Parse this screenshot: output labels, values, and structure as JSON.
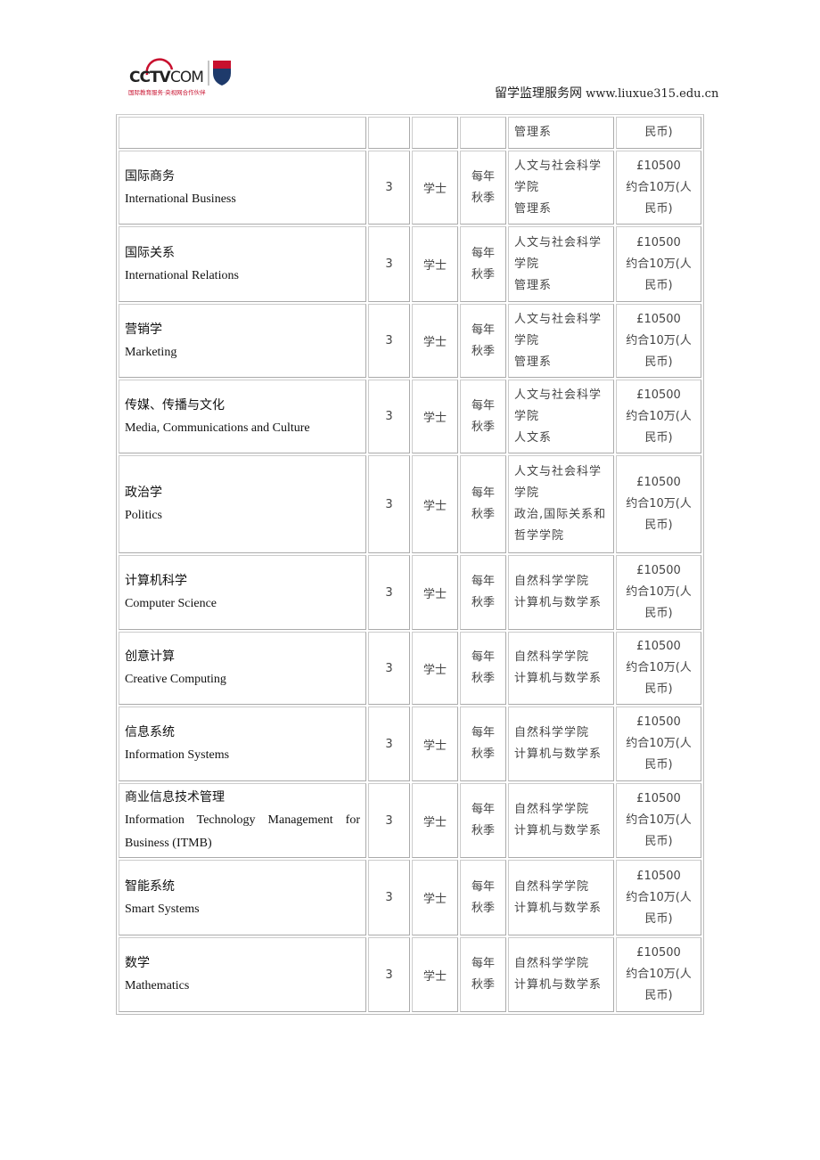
{
  "header": {
    "logo_text": "CCTV.com",
    "logo_tagline": "国际教育服务·央视网合作伙伴",
    "site_name": "留学监理服务网",
    "site_url": "www.liuxue315.edu.cn"
  },
  "rows": [
    {
      "zh": "",
      "en": "",
      "years": "",
      "degree": "",
      "intake": "",
      "faculty": [
        "管理系"
      ],
      "fee": [
        "民币)"
      ]
    },
    {
      "zh": "国际商务",
      "en": "International Business",
      "years": "3",
      "degree": "学士",
      "intake": [
        "每年",
        "秋季"
      ],
      "faculty": [
        "人文与社会科学",
        "学院",
        "管理系"
      ],
      "fee": [
        "£10500",
        "约合10万(人",
        "民币)"
      ]
    },
    {
      "zh": "国际关系",
      "en": "International Relations",
      "years": "3",
      "degree": "学士",
      "intake": [
        "每年",
        "秋季"
      ],
      "faculty": [
        "人文与社会科学",
        "学院",
        "管理系"
      ],
      "fee": [
        "£10500",
        "约合10万(人",
        "民币)"
      ]
    },
    {
      "zh": "营销学",
      "en": "Marketing",
      "years": "3",
      "degree": "学士",
      "intake": [
        "每年",
        "秋季"
      ],
      "faculty": [
        "人文与社会科学",
        "学院",
        "管理系"
      ],
      "fee": [
        "£10500",
        "约合10万(人",
        "民币)"
      ]
    },
    {
      "zh": "传媒、传播与文化",
      "en": "Media, Communications and Culture",
      "years": "3",
      "degree": "学士",
      "intake": [
        "每年",
        "秋季"
      ],
      "faculty": [
        "人文与社会科学",
        "学院",
        "人文系"
      ],
      "fee": [
        "£10500",
        "约合10万(人",
        "民币)"
      ]
    },
    {
      "zh": "政治学",
      "en": "Politics",
      "years": "3",
      "degree": "学士",
      "intake": [
        "每年",
        "秋季"
      ],
      "faculty": [
        "人文与社会科学",
        "学院",
        "政治,国际关系和",
        "哲学学院"
      ],
      "fee": [
        "£10500",
        "约合10万(人",
        "民币)"
      ]
    },
    {
      "zh": "计算机科学",
      "en": "Computer Science",
      "years": "3",
      "degree": "学士",
      "intake": [
        "每年",
        "秋季"
      ],
      "faculty": [
        "自然科学学院",
        "计算机与数学系"
      ],
      "fee": [
        "£10500",
        "约合10万(人",
        "民币)"
      ]
    },
    {
      "zh": "创意计算",
      "en": "Creative Computing",
      "years": "3",
      "degree": "学士",
      "intake": [
        "每年",
        "秋季"
      ],
      "faculty": [
        "自然科学学院",
        "计算机与数学系"
      ],
      "fee": [
        "£10500",
        "约合10万(人",
        "民币)"
      ]
    },
    {
      "zh": "信息系统",
      "en": "Information Systems",
      "years": "3",
      "degree": "学士",
      "intake": [
        "每年",
        "秋季"
      ],
      "faculty": [
        "自然科学学院",
        "计算机与数学系"
      ],
      "fee": [
        "£10500",
        "约合10万(人",
        "民币)"
      ]
    },
    {
      "zh": "商业信息技术管理",
      "en": "Information Technology Management for Business (ITMB)",
      "years": "3",
      "degree": "学士",
      "intake": [
        "每年",
        "秋季"
      ],
      "faculty": [
        "自然科学学院",
        "计算机与数学系"
      ],
      "fee": [
        "£10500",
        "约合10万(人",
        "民币)"
      ]
    },
    {
      "zh": "智能系统",
      "en": "Smart Systems",
      "years": "3",
      "degree": "学士",
      "intake": [
        "每年",
        "秋季"
      ],
      "faculty": [
        "自然科学学院",
        "计算机与数学系"
      ],
      "fee": [
        "£10500",
        "约合10万(人",
        "民币)"
      ]
    },
    {
      "zh": "数学",
      "en": "Mathematics",
      "years": "3",
      "degree": "学士",
      "intake": [
        "每年",
        "秋季"
      ],
      "faculty": [
        "自然科学学院",
        "计算机与数学系"
      ],
      "fee": [
        "£10500",
        "约合10万(人",
        "民币)"
      ]
    }
  ]
}
